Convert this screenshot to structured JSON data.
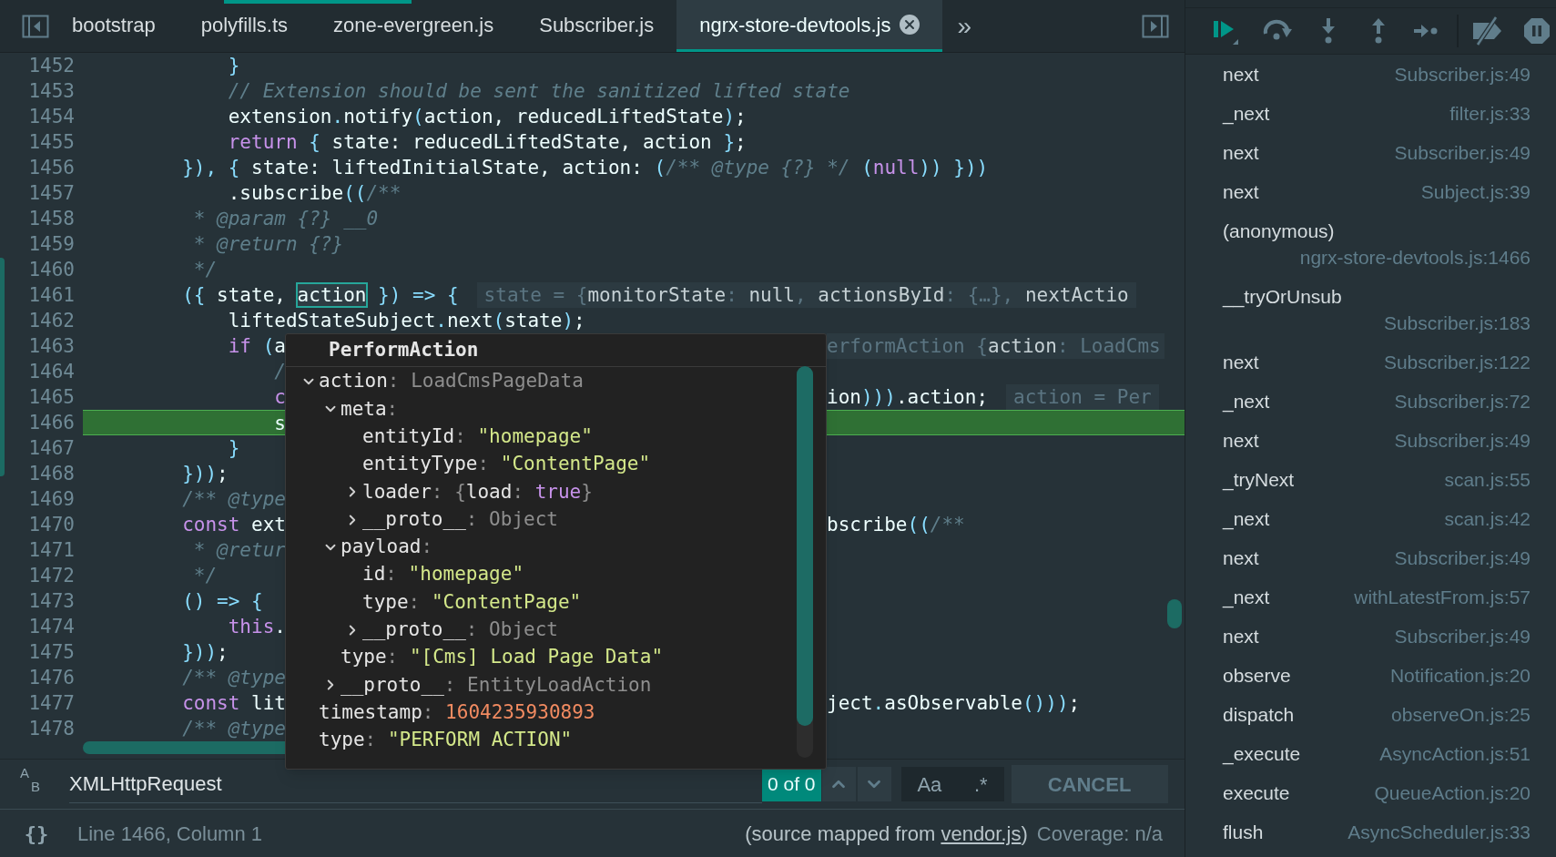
{
  "tabs": [
    {
      "label": "bootstrap",
      "selected": false,
      "closable": false
    },
    {
      "label": "polyfills.ts",
      "selected": false,
      "closable": false
    },
    {
      "label": "zone-evergreen.js",
      "selected": false,
      "closable": false
    },
    {
      "label": "Subscriber.js",
      "selected": false,
      "closable": false
    },
    {
      "label": "ngrx-store-devtools.js",
      "selected": true,
      "closable": true
    }
  ],
  "tab_overflow": "»",
  "code": {
    "lines": [
      {
        "number": "1452",
        "current": false,
        "tokens": [
          {
            "kind": "punc",
            "text": "            }"
          }
        ]
      },
      {
        "number": "1453",
        "current": false,
        "tokens": [
          {
            "kind": "comment",
            "text": "            // Extension should be sent the sanitized lifted state"
          }
        ]
      },
      {
        "number": "1454",
        "current": false,
        "tokens": [
          {
            "kind": "plain",
            "text": "            extension"
          },
          {
            "kind": "punc",
            "text": "."
          },
          {
            "kind": "plain",
            "text": "notify"
          },
          {
            "kind": "punc",
            "text": "("
          },
          {
            "kind": "plain",
            "text": "action, reducedLiftedState"
          },
          {
            "kind": "punc",
            "text": ")"
          },
          {
            "kind": "plain",
            "text": ";"
          }
        ]
      },
      {
        "number": "1455",
        "current": false,
        "tokens": [
          {
            "kind": "keyword",
            "text": "            return"
          },
          {
            "kind": "punc",
            "text": " {"
          },
          {
            "kind": "plain",
            "text": " state: reducedLiftedState, action "
          },
          {
            "kind": "punc",
            "text": "}"
          },
          {
            "kind": "plain",
            "text": ";"
          }
        ]
      },
      {
        "number": "1456",
        "current": false,
        "tokens": [
          {
            "kind": "punc",
            "text": "        }), {"
          },
          {
            "kind": "plain",
            "text": " state: liftedInitialState, action: "
          },
          {
            "kind": "punc",
            "text": "("
          },
          {
            "kind": "comment",
            "text": "/** @type {?} */"
          },
          {
            "kind": "punc",
            "text": " ("
          },
          {
            "kind": "keyword",
            "text": "null"
          },
          {
            "kind": "punc",
            "text": ")) }))"
          }
        ]
      },
      {
        "number": "1457",
        "current": false,
        "tokens": [
          {
            "kind": "plain",
            "text": "            .subscribe"
          },
          {
            "kind": "punc",
            "text": "(("
          },
          {
            "kind": "comment",
            "text": "/**"
          }
        ]
      },
      {
        "number": "1458",
        "current": false,
        "tokens": [
          {
            "kind": "comment",
            "text": "         * @param {?} __0"
          }
        ]
      },
      {
        "number": "1459",
        "current": false,
        "tokens": [
          {
            "kind": "comment",
            "text": "         * @return {?}"
          }
        ]
      },
      {
        "number": "1460",
        "current": false,
        "tokens": [
          {
            "kind": "comment",
            "text": "         */"
          }
        ]
      },
      {
        "number": "1461",
        "current": false,
        "tokens": [
          {
            "kind": "punc",
            "text": "        ({"
          },
          {
            "kind": "plain",
            "text": " state, "
          },
          {
            "kind": "highlight",
            "text": "action"
          },
          {
            "kind": "punc",
            "text": " }) => {"
          }
        ],
        "inline": [
          {
            "kind": "inline_value",
            "text": "state = {"
          },
          {
            "kind": "inline_name",
            "text": "monitorState"
          },
          {
            "kind": "inline_value",
            "text": ": "
          },
          {
            "kind": "inline_name",
            "text": "null"
          },
          {
            "kind": "inline_value",
            "text": ", "
          },
          {
            "kind": "inline_name",
            "text": "actionsById"
          },
          {
            "kind": "inline_value",
            "text": ": {…}, "
          },
          {
            "kind": "inline_name",
            "text": "nextActio"
          }
        ]
      },
      {
        "number": "1462",
        "current": false,
        "tokens": [
          {
            "kind": "plain",
            "text": "            liftedStateSubject"
          },
          {
            "kind": "punc",
            "text": "."
          },
          {
            "kind": "plain",
            "text": "next"
          },
          {
            "kind": "punc",
            "text": "("
          },
          {
            "kind": "plain",
            "text": "state"
          },
          {
            "kind": "punc",
            "text": ")"
          },
          {
            "kind": "plain",
            "text": ";"
          }
        ]
      },
      {
        "number": "1463",
        "current": false,
        "tokens": [
          {
            "kind": "keyword",
            "text": "            if"
          },
          {
            "kind": "punc",
            "text": " ("
          },
          {
            "kind": "plain",
            "text": "a"
          }
        ],
        "right_inline": [
          {
            "kind": "inline_value",
            "text": "erformAction {"
          },
          {
            "kind": "inline_name",
            "text": "action"
          },
          {
            "kind": "inline_value",
            "text": ": LoadCms"
          }
        ]
      },
      {
        "number": "1464",
        "current": false,
        "tokens": [
          {
            "kind": "comment",
            "text": "                /"
          }
        ]
      },
      {
        "number": "1465",
        "current": false,
        "tokens": [
          {
            "kind": "keyword",
            "text": "                c"
          }
        ],
        "right": [
          {
            "kind": "plain",
            "text": "ion"
          },
          {
            "kind": "punc",
            "text": ")))"
          },
          {
            "kind": "plain",
            "text": ".action;"
          }
        ],
        "inline": [
          {
            "kind": "inline_value",
            "text": "action = Per"
          }
        ]
      },
      {
        "number": "1466",
        "current": true,
        "tokens": [
          {
            "kind": "plain",
            "text": "                s"
          }
        ]
      },
      {
        "number": "1467",
        "current": false,
        "tokens": [
          {
            "kind": "punc",
            "text": "            }"
          }
        ]
      },
      {
        "number": "1468",
        "current": false,
        "tokens": [
          {
            "kind": "punc",
            "text": "        }))"
          },
          {
            "kind": "plain",
            "text": ";"
          }
        ]
      },
      {
        "number": "1469",
        "current": false,
        "tokens": [
          {
            "kind": "comment",
            "text": "        /** @type"
          }
        ]
      },
      {
        "number": "1470",
        "current": false,
        "tokens": [
          {
            "kind": "keyword",
            "text": "        const"
          },
          {
            "kind": "plain",
            "text": " ext"
          }
        ],
        "right": [
          {
            "kind": "plain",
            "text": "bscribe"
          },
          {
            "kind": "punc",
            "text": "(("
          },
          {
            "kind": "comment",
            "text": "/**"
          }
        ]
      },
      {
        "number": "1471",
        "current": false,
        "tokens": [
          {
            "kind": "comment",
            "text": "         * @retur"
          }
        ]
      },
      {
        "number": "1472",
        "current": false,
        "tokens": [
          {
            "kind": "comment",
            "text": "         */"
          }
        ]
      },
      {
        "number": "1473",
        "current": false,
        "tokens": [
          {
            "kind": "punc",
            "text": "        () => {"
          }
        ]
      },
      {
        "number": "1474",
        "current": false,
        "tokens": [
          {
            "kind": "keyword",
            "text": "            this"
          },
          {
            "kind": "plain",
            "text": "."
          }
        ]
      },
      {
        "number": "1475",
        "current": false,
        "tokens": [
          {
            "kind": "punc",
            "text": "        }))"
          },
          {
            "kind": "plain",
            "text": ";"
          }
        ]
      },
      {
        "number": "1476",
        "current": false,
        "tokens": [
          {
            "kind": "comment",
            "text": "        /** @type"
          }
        ]
      },
      {
        "number": "1477",
        "current": false,
        "tokens": [
          {
            "kind": "keyword",
            "text": "        const"
          },
          {
            "kind": "plain",
            "text": " lit"
          }
        ],
        "right": [
          {
            "kind": "plain",
            "text": "ject"
          },
          {
            "kind": "punc",
            "text": "."
          },
          {
            "kind": "plain",
            "text": "asObservable"
          },
          {
            "kind": "punc",
            "text": "()))"
          },
          {
            "kind": "plain",
            "text": ";"
          }
        ]
      },
      {
        "number": "1478",
        "current": false,
        "tokens": [
          {
            "kind": "comment",
            "text": "        /** @type"
          }
        ]
      }
    ]
  },
  "popup": {
    "title": "PerformAction",
    "tree": [
      {
        "key": "action",
        "expanded": true,
        "value": [
          {
            "kind": "punc",
            "text": ": "
          },
          {
            "kind": "type",
            "text": "LoadCmsPageData"
          }
        ],
        "children": [
          {
            "key": "meta",
            "expanded": true,
            "value": [
              {
                "kind": "punc",
                "text": ":"
              }
            ],
            "children": [
              {
                "key": "entityId",
                "value": [
                  {
                    "kind": "punc",
                    "text": ": "
                  },
                  {
                    "kind": "string",
                    "text": "\"homepage\""
                  }
                ]
              },
              {
                "key": "entityType",
                "value": [
                  {
                    "kind": "punc",
                    "text": ": "
                  },
                  {
                    "kind": "string",
                    "text": "\"ContentPage\""
                  }
                ]
              },
              {
                "key": "loader",
                "expanded": false,
                "value": [
                  {
                    "kind": "punc",
                    "text": ": {"
                  },
                  {
                    "kind": "key",
                    "text": "load"
                  },
                  {
                    "kind": "punc",
                    "text": ": "
                  },
                  {
                    "kind": "keyword",
                    "text": "true"
                  },
                  {
                    "kind": "punc",
                    "text": "}"
                  }
                ]
              },
              {
                "key": "__proto__",
                "expanded": false,
                "value": [
                  {
                    "kind": "punc",
                    "text": ": "
                  },
                  {
                    "kind": "type",
                    "text": "Object"
                  }
                ]
              }
            ]
          },
          {
            "key": "payload",
            "expanded": true,
            "value": [
              {
                "kind": "punc",
                "text": ":"
              }
            ],
            "children": [
              {
                "key": "id",
                "value": [
                  {
                    "kind": "punc",
                    "text": ": "
                  },
                  {
                    "kind": "string",
                    "text": "\"homepage\""
                  }
                ]
              },
              {
                "key": "type",
                "value": [
                  {
                    "kind": "punc",
                    "text": ": "
                  },
                  {
                    "kind": "string",
                    "text": "\"ContentPage\""
                  }
                ]
              },
              {
                "key": "__proto__",
                "expanded": false,
                "value": [
                  {
                    "kind": "punc",
                    "text": ": "
                  },
                  {
                    "kind": "type",
                    "text": "Object"
                  }
                ]
              }
            ]
          },
          {
            "key": "type",
            "value": [
              {
                "kind": "punc",
                "text": ": "
              },
              {
                "kind": "string",
                "text": "\"[Cms] Load Page Data\""
              }
            ]
          },
          {
            "key": "__proto__",
            "expanded": false,
            "value": [
              {
                "kind": "punc",
                "text": ": "
              },
              {
                "kind": "type",
                "text": "EntityLoadAction"
              }
            ]
          }
        ]
      },
      {
        "key": "timestamp",
        "value": [
          {
            "kind": "punc",
            "text": ": "
          },
          {
            "kind": "number",
            "text": "1604235930893"
          }
        ]
      },
      {
        "key": "type",
        "value": [
          {
            "kind": "punc",
            "text": ": "
          },
          {
            "kind": "string",
            "text": "\"PERFORM ACTION\""
          }
        ]
      }
    ]
  },
  "search": {
    "replace_letters": [
      "A",
      "B"
    ],
    "value": "XMLHttpRequest",
    "matches": "0 of 0",
    "case_toggle": "Aa",
    "regex_toggle": ".*",
    "cancel": "CANCEL"
  },
  "status_bar": {
    "format_icon": "{}",
    "position": "Line 1466, Column 1",
    "source_prefix": "(source mapped from ",
    "source_link": "vendor.js",
    "source_suffix": ")",
    "coverage": "Coverage: n/a"
  },
  "call_stack": [
    {
      "name": "next",
      "location": "Subscriber.js:49"
    },
    {
      "name": "_next",
      "location": "filter.js:33"
    },
    {
      "name": "next",
      "location": "Subscriber.js:49"
    },
    {
      "name": "next",
      "location": "Subject.js:39"
    },
    {
      "name": "(anonymous)",
      "location": "ngrx-store-devtools.js:1466"
    },
    {
      "name": "__tryOrUnsub",
      "location": "Subscriber.js:183"
    },
    {
      "name": "next",
      "location": "Subscriber.js:122"
    },
    {
      "name": "_next",
      "location": "Subscriber.js:72"
    },
    {
      "name": "next",
      "location": "Subscriber.js:49"
    },
    {
      "name": "_tryNext",
      "location": "scan.js:55"
    },
    {
      "name": "_next",
      "location": "scan.js:42"
    },
    {
      "name": "next",
      "location": "Subscriber.js:49"
    },
    {
      "name": "_next",
      "location": "withLatestFrom.js:57"
    },
    {
      "name": "next",
      "location": "Subscriber.js:49"
    },
    {
      "name": "observe",
      "location": "Notification.js:20"
    },
    {
      "name": "dispatch",
      "location": "observeOn.js:25"
    },
    {
      "name": "_execute",
      "location": "AsyncAction.js:51"
    },
    {
      "name": "execute",
      "location": "QueueAction.js:20"
    },
    {
      "name": "flush",
      "location": "AsyncScheduler.js:33"
    }
  ]
}
